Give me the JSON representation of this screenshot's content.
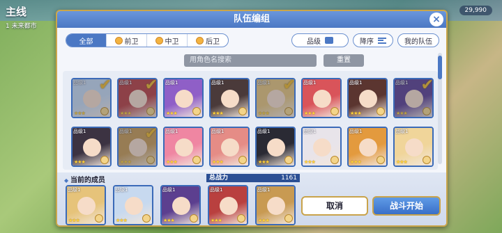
{
  "background": {
    "title": "主线",
    "subtitle": "1 未来都市",
    "counter": "29,990"
  },
  "dialog": {
    "title": "队伍编组",
    "close_label": "×"
  },
  "filters": {
    "tabs": [
      {
        "label": "全部",
        "active": true
      },
      {
        "label": "前卫",
        "active": false
      },
      {
        "label": "中卫",
        "active": false
      },
      {
        "label": "后卫",
        "active": false
      }
    ],
    "grade_label": "品级",
    "sort_label": "降序",
    "my_team_label": "我的队伍"
  },
  "search": {
    "placeholder": "用角色名搜索",
    "reset_label": "重置"
  },
  "roster": [
    {
      "level": "品级1",
      "stars": "★★★",
      "selected": true,
      "color": "#c7d9ef"
    },
    {
      "level": "品级1",
      "stars": "★★★",
      "selected": true,
      "color": "#b9403f"
    },
    {
      "level": "品级1",
      "stars": "★★★",
      "selected": false,
      "color": "#8f5fc7"
    },
    {
      "level": "品级1",
      "stars": "★★★",
      "selected": false,
      "color": "#4a3a3a"
    },
    {
      "level": "品级1",
      "stars": "★★★",
      "selected": true,
      "color": "#e6c37a"
    },
    {
      "level": "品级1",
      "stars": "★★★",
      "selected": false,
      "color": "#d9545a"
    },
    {
      "level": "品级1",
      "stars": "★★★",
      "selected": false,
      "color": "#5b3530"
    },
    {
      "level": "品级1",
      "stars": "★★★",
      "selected": true,
      "color": "#5c3f8f"
    },
    {
      "level": "品级1",
      "stars": "★★★",
      "selected": false,
      "color": "#3c3342"
    },
    {
      "level": "品级1",
      "stars": "★★★",
      "selected": true,
      "color": "#c89a52"
    },
    {
      "level": "品级1",
      "stars": "★★★",
      "selected": false,
      "color": "#ef86a2"
    },
    {
      "level": "品级1",
      "stars": "★★★",
      "selected": false,
      "color": "#e58c86"
    },
    {
      "level": "品级1",
      "stars": "★★★",
      "selected": false,
      "color": "#2a2a34"
    },
    {
      "level": "品级1",
      "stars": "★★★",
      "selected": false,
      "color": "#e8e4ea"
    },
    {
      "level": "品级1",
      "stars": "★★★",
      "selected": false,
      "color": "#e39a3e"
    },
    {
      "level": "品级1",
      "stars": "★★★",
      "selected": false,
      "color": "#f0d59a"
    }
  ],
  "team": {
    "label": "当前的成员",
    "power_label": "总战力",
    "power_value": "1161",
    "members": [
      {
        "level": "品级1",
        "stars": "★★★",
        "color": "#e6c37a"
      },
      {
        "level": "品级1",
        "stars": "★★★",
        "color": "#c7d9ef"
      },
      {
        "level": "品级1",
        "stars": "★★★",
        "color": "#5c3f8f"
      },
      {
        "level": "品级1",
        "stars": "★★★",
        "color": "#b9403f"
      },
      {
        "level": "品级1",
        "stars": "★★★",
        "color": "#c89a52"
      }
    ]
  },
  "actions": {
    "cancel_label": "取消",
    "start_label": "战斗开始"
  }
}
